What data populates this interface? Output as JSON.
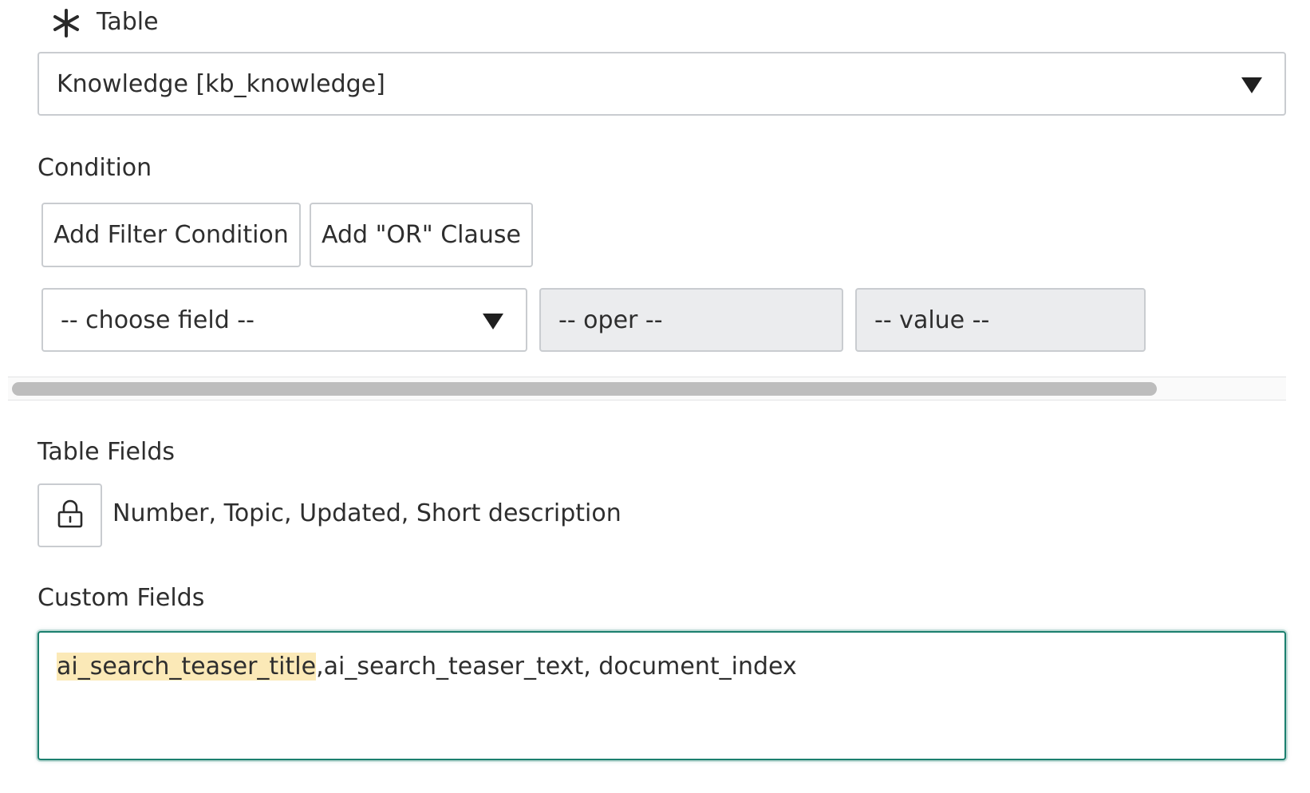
{
  "table": {
    "label": "Table",
    "required_icon": "asterisk-icon",
    "selected": "Knowledge [kb_knowledge]"
  },
  "condition": {
    "label": "Condition",
    "add_filter_label": "Add Filter Condition",
    "add_or_label": "Add \"OR\" Clause",
    "field_placeholder": "-- choose field --",
    "oper_placeholder": "-- oper --",
    "value_placeholder": "-- value --"
  },
  "table_fields": {
    "label": "Table Fields",
    "lock_icon": "lock-icon",
    "value": "Number, Topic, Updated, Short description"
  },
  "custom_fields": {
    "label": "Custom Fields",
    "value_highlighted": "ai_search_teaser_title",
    "value_rest": ",ai_search_teaser_text, document_index",
    "highlight_color": "#fbe9b7",
    "focus_color": "#1b7f6e"
  }
}
